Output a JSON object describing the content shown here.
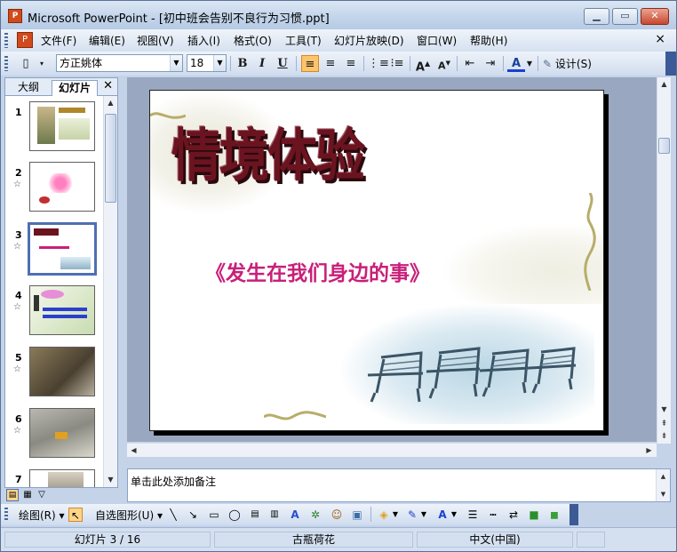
{
  "window": {
    "app_icon": "powerpoint-icon",
    "title": "Microsoft PowerPoint - [初中班会告别不良行为习惯.ppt]",
    "min_symbol": "▁",
    "max_symbol": "▭",
    "close_symbol": "✕"
  },
  "menu": {
    "items": [
      "文件(F)",
      "编辑(E)",
      "视图(V)",
      "插入(I)",
      "格式(O)",
      "工具(T)",
      "幻灯片放映(D)",
      "窗口(W)",
      "帮助(H)"
    ],
    "close_symbol": "×"
  },
  "toolbar": {
    "font_name": "方正姚体",
    "font_size": "18",
    "bold": "B",
    "italic": "I",
    "underline": "U",
    "grow": "A",
    "shrink": "A",
    "font_color": "A",
    "design_label": "设计(S)"
  },
  "left_pane": {
    "tab_outline": "大纲",
    "tab_slides": "幻灯片",
    "close_symbol": "✕",
    "thumbnails": [
      {
        "num": "1",
        "star": ""
      },
      {
        "num": "2",
        "star": "☆"
      },
      {
        "num": "3",
        "star": "☆"
      },
      {
        "num": "4",
        "star": "☆"
      },
      {
        "num": "5",
        "star": "☆"
      },
      {
        "num": "6",
        "star": "☆"
      },
      {
        "num": "7",
        "star": ""
      }
    ],
    "selected": 3
  },
  "slide": {
    "title": "情境体验",
    "subtitle": "《发生在我们身边的事》",
    "title_color": "#6b1420",
    "subtitle_color": "#c8207a"
  },
  "notes": {
    "placeholder": "单击此处添加备注"
  },
  "draw_toolbar": {
    "draw_label": "绘图(R)",
    "autoshape_label": "自选图形(U)"
  },
  "status": {
    "slide_info": "幻灯片 3 / 16",
    "template": "古瓶荷花",
    "language": "中文(中国)"
  }
}
